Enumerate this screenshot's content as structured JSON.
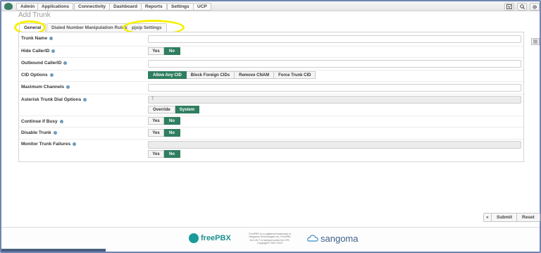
{
  "navbar": {
    "items": [
      "Admin",
      "Applications",
      "Connectivity",
      "Dashboard",
      "Reports",
      "Settings",
      "UCP"
    ],
    "icons": [
      "language-icon",
      "search-icon",
      "gear-icon"
    ]
  },
  "page": {
    "title": "Add Trunk"
  },
  "tabs": [
    {
      "label": "General",
      "active": true
    },
    {
      "label": "Dialed Number Manipulation Rules",
      "active": false
    },
    {
      "label": "pjsip Settings",
      "active": false
    }
  ],
  "form": {
    "trunk_name": {
      "label": "Trunk Name",
      "value": ""
    },
    "hide_callerid": {
      "label": "Hide CallerID",
      "options": [
        "Yes",
        "No"
      ],
      "selected": "No"
    },
    "outbound_callerid": {
      "label": "Outbound CallerID",
      "value": ""
    },
    "cid_options": {
      "label": "CID Options",
      "options": [
        "Allow Any CID",
        "Block Foreign CIDs",
        "Remove CNAM",
        "Force Trunk CID"
      ],
      "selected": "Allow Any CID"
    },
    "max_channels": {
      "label": "Maximum Channels",
      "value": ""
    },
    "dial_options": {
      "label": "Asterisk Trunk Dial Options",
      "value": "T",
      "options": [
        "Override",
        "System"
      ],
      "selected": "System"
    },
    "continue_if_busy": {
      "label": "Continue if Busy",
      "options": [
        "Yes",
        "No"
      ],
      "selected": "No"
    },
    "disable_trunk": {
      "label": "Disable Trunk",
      "options": [
        "Yes",
        "No"
      ],
      "selected": "No"
    },
    "monitor_failures": {
      "label": "Monitor Trunk Failures",
      "value": "",
      "options": [
        "Yes",
        "No"
      ],
      "selected": "No"
    }
  },
  "actions": {
    "collapse": "»",
    "submit": "Submit",
    "reset": "Reset"
  },
  "footer": {
    "brand": "freePBX",
    "legal": "FreePBX is a registered trademark of Sangoma Technologies Inc. FreePBX 16.0.40.7 is licensed under the GPL Copyright© 2007-2024",
    "company": "sangoma"
  },
  "colors": {
    "accent": "#2f7e5f",
    "highlight": "#f7f000",
    "nav_border": "#6f86b3"
  }
}
